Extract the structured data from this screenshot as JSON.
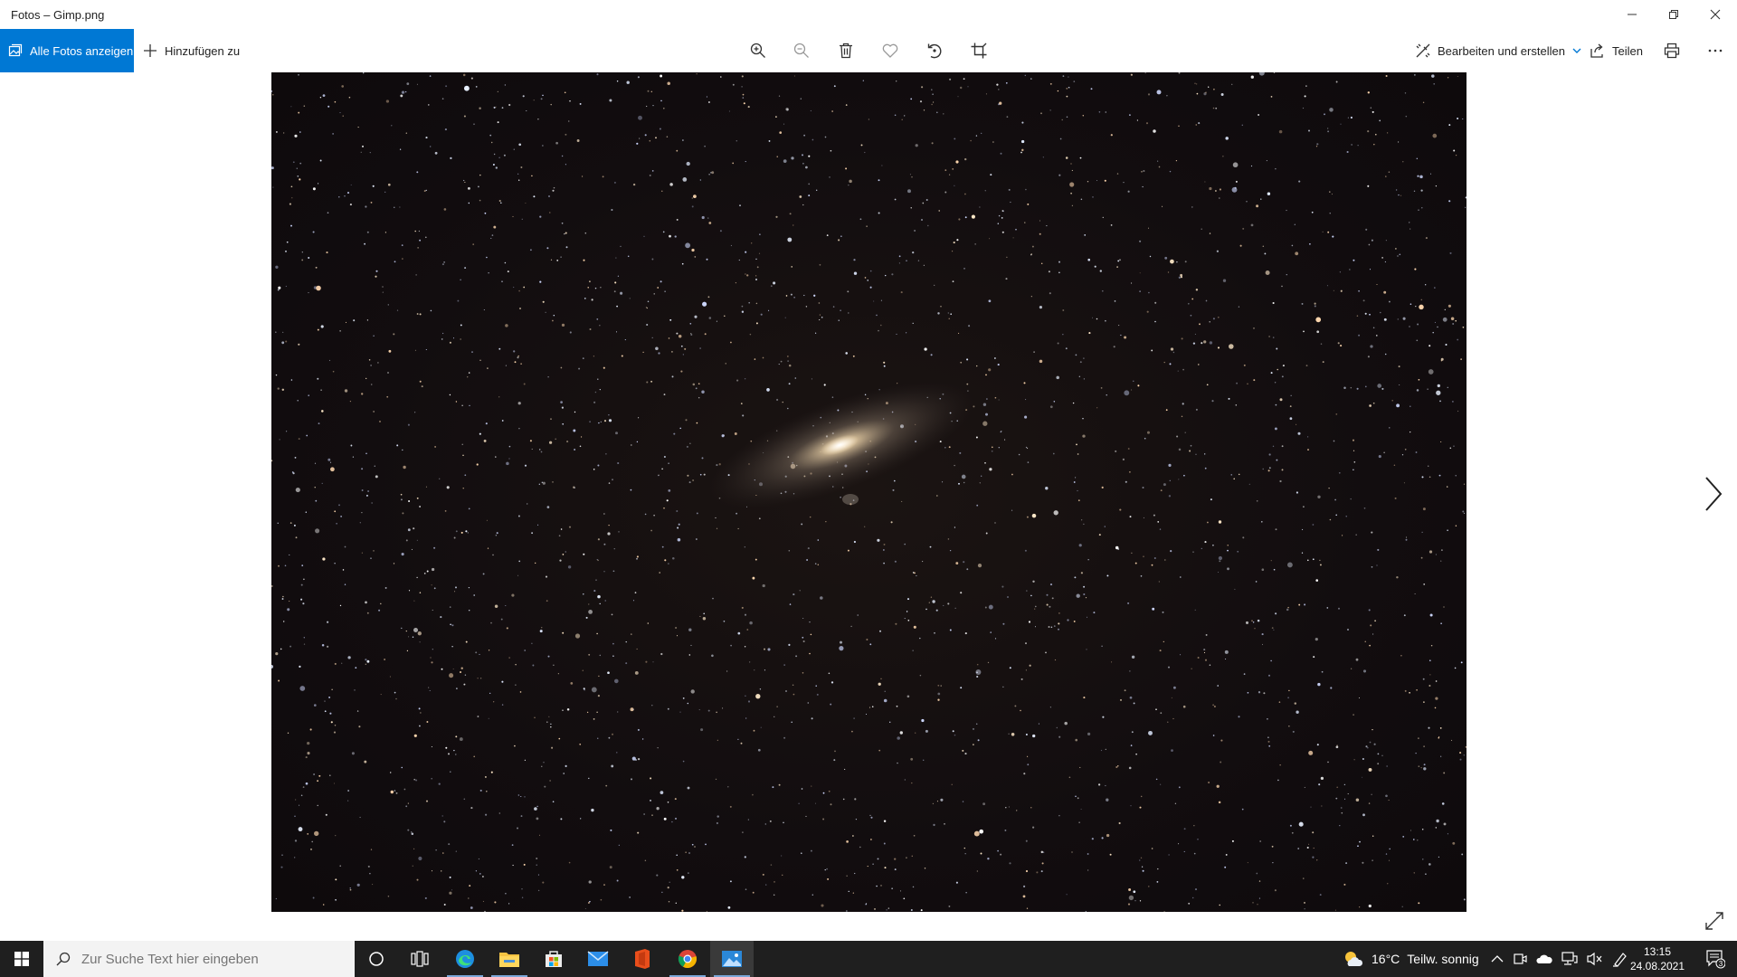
{
  "window": {
    "title": "Fotos – Gimp.png"
  },
  "toolbar": {
    "all_photos_label": "Alle Fotos anzeigen",
    "add_to_label": "Hinzufügen zu",
    "edit_create_label": "Bearbeiten und erstellen",
    "share_label": "Teilen",
    "icons": [
      "zoom-in-icon",
      "zoom-out-icon",
      "delete-icon",
      "favorite-icon",
      "rotate-icon",
      "crop-icon",
      "print-icon",
      "more-icon"
    ]
  },
  "viewer": {
    "image_description_hidden": ""
  },
  "taskbar": {
    "search_placeholder": "Zur Suche Text hier eingeben",
    "weather_temp": "16°C",
    "weather_text": "Teilw. sonnig",
    "time": "13:15",
    "date": "24.08.2021",
    "notification_count": "3"
  },
  "colors": {
    "accent": "#0078d4",
    "taskbar": "#1f1f1f"
  }
}
